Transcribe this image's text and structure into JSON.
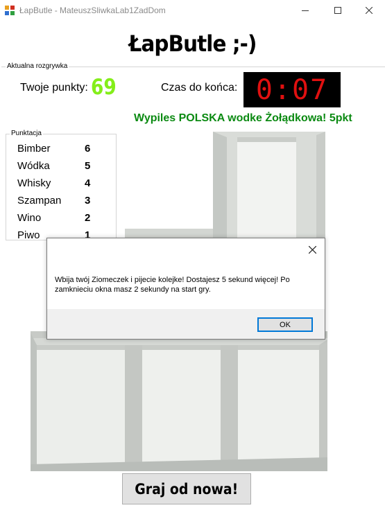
{
  "window": {
    "title": "ŁapButle - MateuszSliwkaLab1ZadDom",
    "minimize_icon": "minimize-icon",
    "maximize_icon": "maximize-icon",
    "close_icon": "close-icon"
  },
  "heading": "ŁapButle ;-)",
  "game_group": {
    "legend": "Aktualna rozgrywka",
    "points_label": "Twoje punkty:",
    "points_value": "69",
    "time_label": "Czas do końca:",
    "time_value": "0:07",
    "last_drink_message": "Wypiles POLSKA wodke Żołądkowa! 5pkt"
  },
  "score_group": {
    "legend": "Punktacja",
    "items": [
      {
        "name": "Bimber",
        "points": "6"
      },
      {
        "name": "Wódka",
        "points": "5"
      },
      {
        "name": "Whisky",
        "points": "4"
      },
      {
        "name": "Szampan",
        "points": "3"
      },
      {
        "name": "Wino",
        "points": "2"
      },
      {
        "name": "Piwo",
        "points": "1"
      }
    ]
  },
  "dialog": {
    "message": "Wbija twój Ziomeczek i pijecie kolejke! Dostajesz 5 sekund więcej! Po zamknieciu okna masz 2 sekundy na start gry.",
    "ok_label": "OK"
  },
  "restart_button": "Graj od nowa!",
  "colors": {
    "points": "#84ee1a",
    "timer_digits": "#e01010",
    "timer_background": "#000000",
    "message": "#0b8a12",
    "dialog_focus": "#0078d7"
  }
}
